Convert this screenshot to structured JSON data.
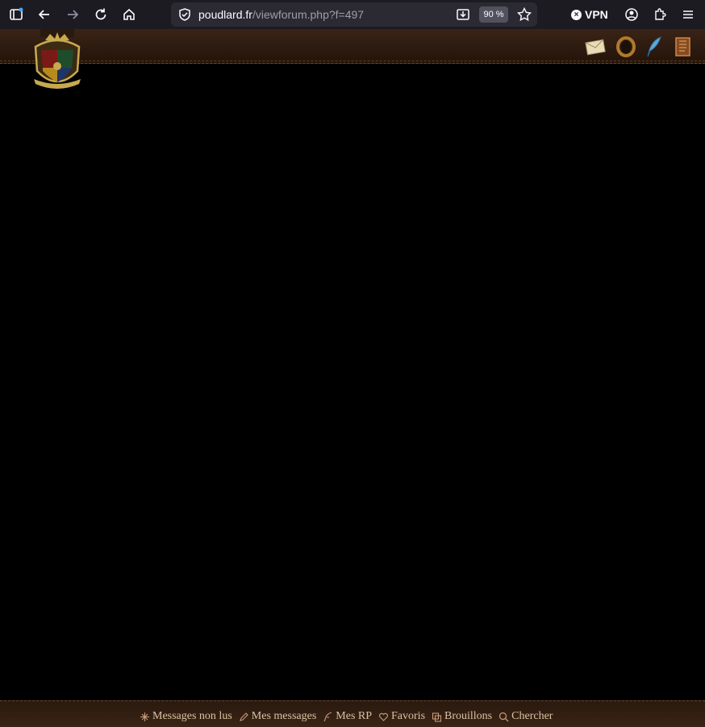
{
  "browser": {
    "url_domain": "poudlard.fr",
    "url_path": "/viewforum.php?f=497",
    "zoom": "90 %",
    "vpn_label": "VPN",
    "icons": [
      "sidebar-icon",
      "back-icon",
      "forward-icon",
      "reload-icon",
      "home-icon",
      "shield-icon",
      "download-icon",
      "star-icon",
      "account-icon",
      "extensions-icon",
      "menu-icon"
    ]
  },
  "header": {
    "crest": "hogwarts-crest",
    "icons": [
      "envelope-icon",
      "ring-icon",
      "quill-icon",
      "scroll-icon"
    ]
  },
  "footer": {
    "items": [
      {
        "label": "Messages non lus",
        "icon": "sparkle-icon"
      },
      {
        "label": "Mes messages",
        "icon": "pencil-icon"
      },
      {
        "label": "Mes RP",
        "icon": "feather-icon"
      },
      {
        "label": "Favoris",
        "icon": "heart-icon"
      },
      {
        "label": "Brouillons",
        "icon": "drafts-icon"
      },
      {
        "label": "Chercher",
        "icon": "search-icon"
      }
    ]
  },
  "colors": {
    "browser_bg": "#1c1b22",
    "header_brown": "#3a2416",
    "footer_text": "#d9c2a3",
    "content_bg": "#000000"
  }
}
